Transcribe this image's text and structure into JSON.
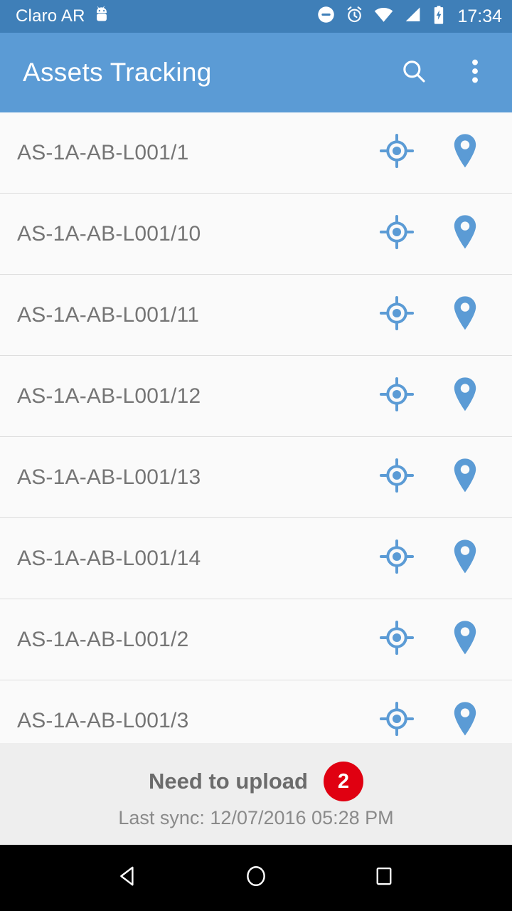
{
  "status_bar": {
    "carrier": "Claro AR",
    "time": "17:34",
    "icons": [
      "android-head-icon",
      "do-not-disturb-icon",
      "alarm-icon",
      "wifi-icon",
      "cell-signal-icon",
      "battery-charging-icon"
    ],
    "background_color": "#3F7FB8",
    "text_color": "#FFFFFF"
  },
  "app_bar": {
    "title": "Assets Tracking",
    "search_label": "Search",
    "overflow_label": "More options",
    "background_color": "#5B9BD5",
    "text_color": "#FFFFFF"
  },
  "list": {
    "row_icons": [
      "gps-fixed-icon",
      "map-pin-icon"
    ],
    "icon_color": "#5B9BD5",
    "text_color": "#757575",
    "divider_color": "#DEDEDE",
    "items": [
      {
        "label": "AS-1A-AB-L001/1"
      },
      {
        "label": "AS-1A-AB-L001/10"
      },
      {
        "label": "AS-1A-AB-L001/11"
      },
      {
        "label": "AS-1A-AB-L001/12"
      },
      {
        "label": "AS-1A-AB-L001/13"
      },
      {
        "label": "AS-1A-AB-L001/14"
      },
      {
        "label": "AS-1A-AB-L001/2"
      },
      {
        "label": "AS-1A-AB-L001/3"
      }
    ]
  },
  "footer": {
    "upload_text": "Need to upload",
    "upload_count": "2",
    "badge_color": "#E00011",
    "sync_text": "Last sync: 12/07/2016 05:28 PM",
    "background_color": "#EEEEEE"
  },
  "nav_bar": {
    "back_label": "Back",
    "home_label": "Home",
    "recents_label": "Recents",
    "background_color": "#000000"
  }
}
